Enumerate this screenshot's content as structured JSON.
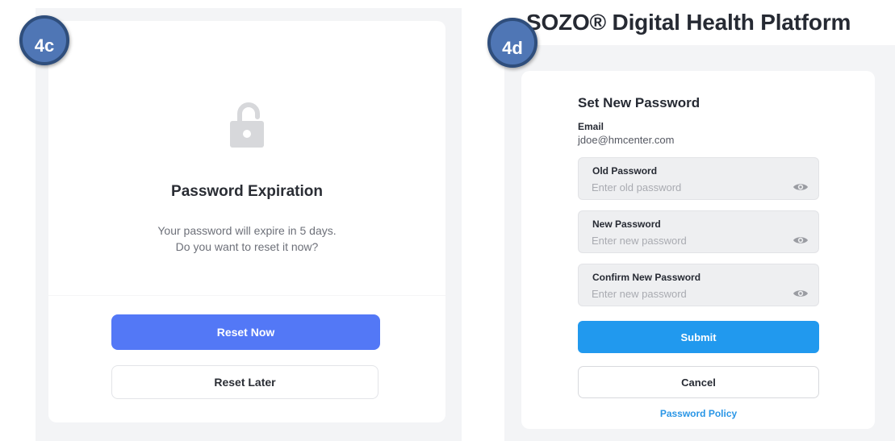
{
  "badges": {
    "left": "4c",
    "right": "4d"
  },
  "expiration_dialog": {
    "icon": "open-padlock-icon",
    "title": "Password Expiration",
    "message_line1": "Your password will expire in 5 days.",
    "message_line2": "Do you want to reset it now?",
    "reset_now_label": "Reset Now",
    "reset_later_label": "Reset Later"
  },
  "set_password_form": {
    "platform_title": "SOZO® Digital Health Platform",
    "title": "Set New Password",
    "email_label": "Email",
    "email_value": "jdoe@hmcenter.com",
    "fields": [
      {
        "label": "Old Password",
        "placeholder": "Enter old password",
        "icon": "eye-icon"
      },
      {
        "label": "New Password",
        "placeholder": "Enter new password",
        "icon": "eye-icon"
      },
      {
        "label": "Confirm New Password",
        "placeholder": "Enter new password",
        "icon": "eye-icon"
      }
    ],
    "submit_label": "Submit",
    "cancel_label": "Cancel",
    "policy_link": "Password Policy"
  },
  "colors": {
    "reset_now_button": "#5378f6",
    "submit_button": "#2199ee",
    "link": "#2a96e6",
    "badge_fill": "#4f76b5",
    "badge_border": "#2f4e7c"
  }
}
